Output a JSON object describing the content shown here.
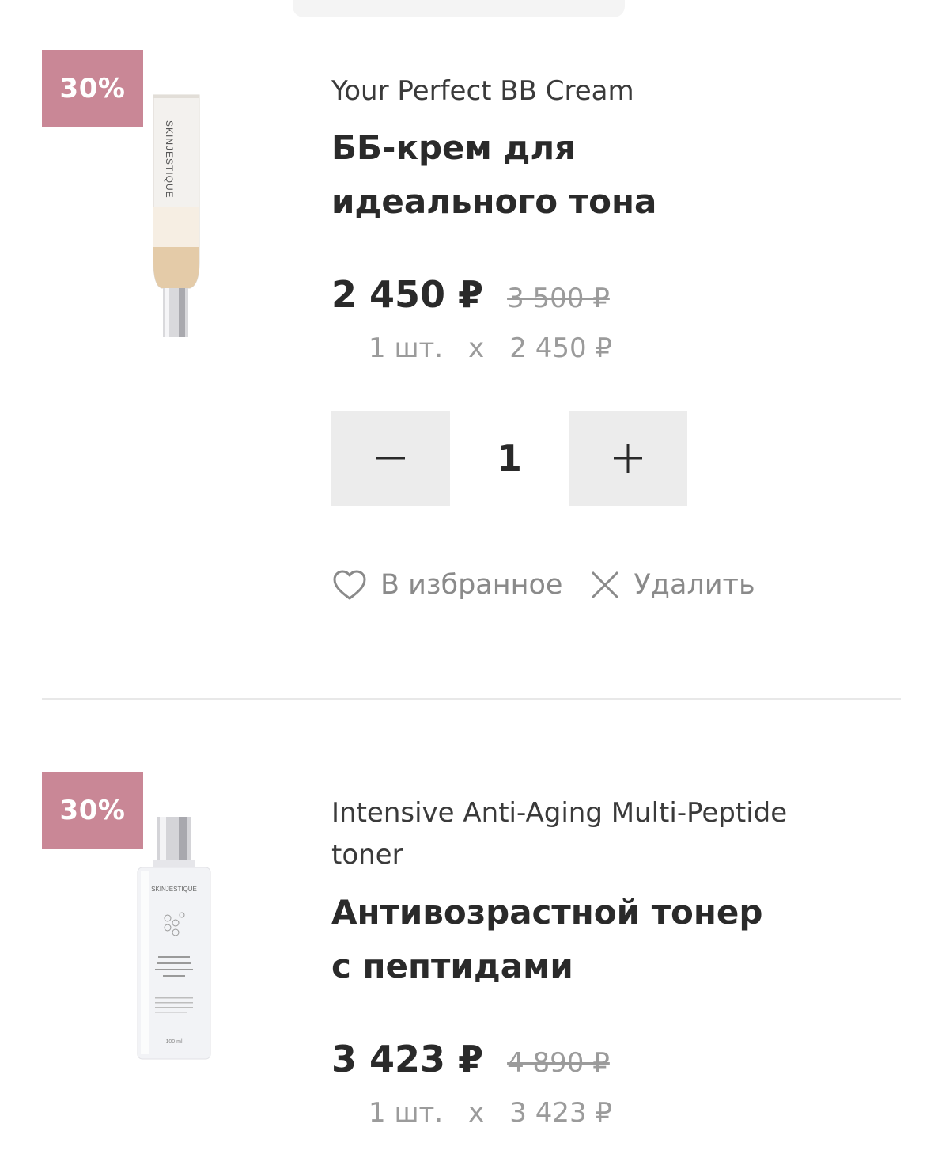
{
  "cart": {
    "items": [
      {
        "discount_badge": "30%",
        "name_en": "Your Perfect BB Cream",
        "name_ru": "ББ-крем для идеального тона",
        "price_current": "2 450 ₽",
        "price_old": "3 500 ₽",
        "unit_qty": "1 шт.",
        "unit_multiplier": "x",
        "unit_price": "2 450 ₽",
        "quantity": "1",
        "favorite_label": "В избранное",
        "remove_label": "Удалить",
        "image_brand": "SKINJESTIQUE"
      },
      {
        "discount_badge": "30%",
        "name_en": "Intensive Anti-Aging Multi-Peptide toner",
        "name_ru": "Антивозрастной тонер с пептидами",
        "price_current": "3 423 ₽",
        "price_old": "4 890 ₽",
        "unit_qty": "1 шт.",
        "unit_multiplier": "x",
        "unit_price": "3 423 ₽",
        "image_brand": "SKINJESTIQUE",
        "image_label": "INTENSIVE ANTI-AGING MULTI-PEPTIDE TONER",
        "image_volume": "100 ml"
      }
    ]
  },
  "icons": {
    "minus": "minus-icon",
    "plus": "plus-icon",
    "favorite": "heart-icon",
    "remove": "close-icon"
  },
  "colors": {
    "badge": "#c98796",
    "qty_button": "#ececec",
    "muted_text": "#9b9b9b",
    "primary_text": "#2a2a2a"
  }
}
